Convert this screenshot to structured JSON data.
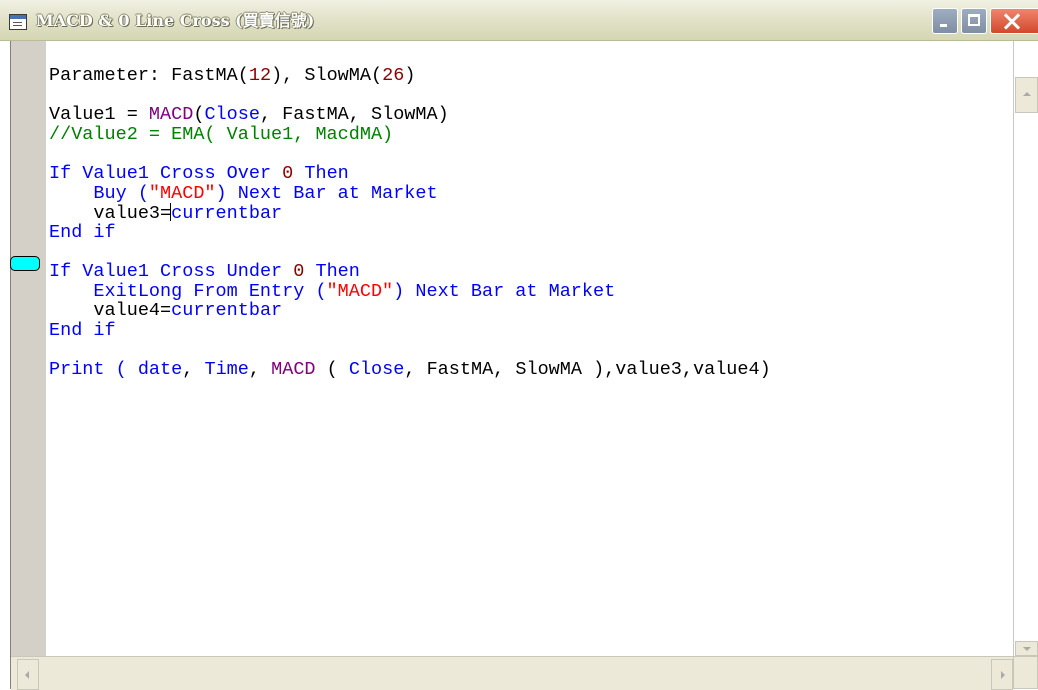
{
  "window": {
    "title": "MACD & 0 Line Cross (買賣信號)",
    "icon": "document-window-icon"
  },
  "editor": {
    "breakpoint_line": 8,
    "cursor_line": 8,
    "lines": [
      [
        {
          "t": "Parameter: FastMA(",
          "c": "plain"
        },
        {
          "t": "12",
          "c": "num"
        },
        {
          "t": "), SlowMA(",
          "c": "plain"
        },
        {
          "t": "26",
          "c": "num"
        },
        {
          "t": ")",
          "c": "plain"
        }
      ],
      [],
      [
        {
          "t": "Value1 = ",
          "c": "plain"
        },
        {
          "t": "MACD",
          "c": "fn"
        },
        {
          "t": "(",
          "c": "plain"
        },
        {
          "t": "Close",
          "c": "kw"
        },
        {
          "t": ", FastMA, SlowMA)",
          "c": "plain"
        }
      ],
      [
        {
          "t": "//Value2 = EMA( Value1, MacdMA)",
          "c": "cm"
        }
      ],
      [],
      [
        {
          "t": "If Value1 ",
          "c": "kw"
        },
        {
          "t": "Cross Over ",
          "c": "kw"
        },
        {
          "t": "0",
          "c": "num"
        },
        {
          "t": " Then",
          "c": "kw"
        }
      ],
      [
        {
          "t": "    Buy (",
          "c": "kw"
        },
        {
          "t": "\"MACD\"",
          "c": "str"
        },
        {
          "t": ") Next Bar at Market",
          "c": "kw"
        }
      ],
      [
        {
          "t": "    value3=",
          "c": "plain"
        },
        {
          "t": "|",
          "c": "cursor"
        },
        {
          "t": "currentbar",
          "c": "kw"
        }
      ],
      [
        {
          "t": "End if",
          "c": "kw"
        }
      ],
      [],
      [
        {
          "t": "If Value1 ",
          "c": "kw"
        },
        {
          "t": "Cross Under ",
          "c": "kw"
        },
        {
          "t": "0",
          "c": "num"
        },
        {
          "t": " Then",
          "c": "kw"
        }
      ],
      [
        {
          "t": "    ExitLong From Entry (",
          "c": "kw"
        },
        {
          "t": "\"MACD\"",
          "c": "str"
        },
        {
          "t": ") Next Bar at Market",
          "c": "kw"
        }
      ],
      [
        {
          "t": "    value4=",
          "c": "plain"
        },
        {
          "t": "currentbar",
          "c": "kw"
        }
      ],
      [
        {
          "t": "End if",
          "c": "kw"
        }
      ],
      [],
      [
        {
          "t": "Print ( ",
          "c": "kw"
        },
        {
          "t": "date",
          "c": "kw"
        },
        {
          "t": ", ",
          "c": "plain"
        },
        {
          "t": "Time",
          "c": "kw"
        },
        {
          "t": ", ",
          "c": "plain"
        },
        {
          "t": "MACD",
          "c": "fn"
        },
        {
          "t": " ( ",
          "c": "plain"
        },
        {
          "t": "Close",
          "c": "kw"
        },
        {
          "t": ", FastMA, SlowMA ),value3,value4)",
          "c": "plain"
        }
      ]
    ]
  },
  "colors": {
    "keyword": "#0000ff",
    "number": "#8b0000",
    "function": "#800080",
    "string": "#ff0000",
    "comment": "#008000",
    "breakpoint": "#00ffff"
  }
}
